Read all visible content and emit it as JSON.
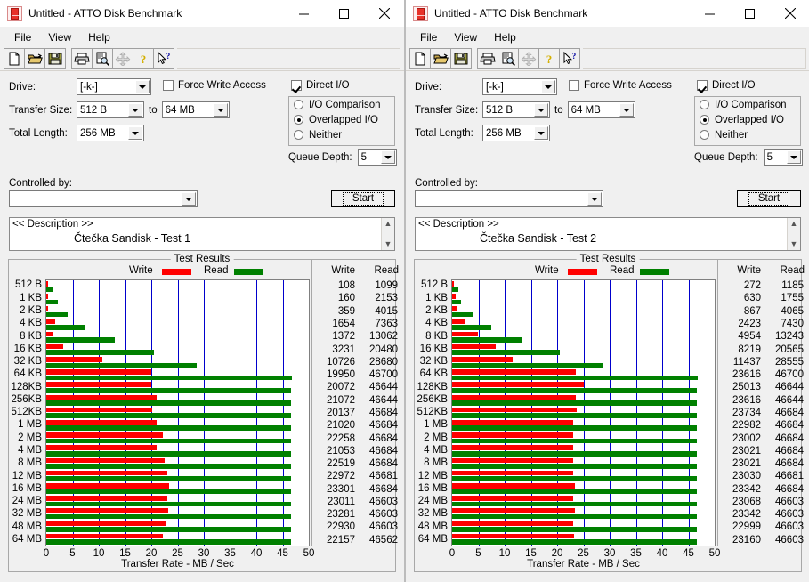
{
  "colors": {
    "write": "#ff0000",
    "read": "#008000",
    "grid": "#0000cc",
    "window_bg": "#f0f0f0",
    "titlebar_bg": "#ffffff"
  },
  "windows": [
    {
      "id": "left",
      "title": "Untitled - ATTO Disk Benchmark",
      "title_icon": "disk-benchmark-icon",
      "window_controls": {
        "minimize": "minimize-icon",
        "maximize": "maximize-icon",
        "close": "close-icon"
      },
      "menu": [
        "File",
        "View",
        "Help"
      ],
      "toolbar": [
        "new-icon",
        "open-icon",
        "save-icon",
        "print-icon",
        "print-preview-icon",
        "move-icon",
        "about-icon",
        "help-icon"
      ],
      "controls": {
        "drive_label": "Drive:",
        "drive_value": "[-k-]",
        "transfer_size_label": "Transfer Size:",
        "transfer_size_from": "512 B",
        "to_label": "to",
        "transfer_size_to": "64 MB",
        "total_length_label": "Total Length:",
        "total_length_value": "256 MB",
        "force_write_access_label": "Force Write Access",
        "force_write_access_checked": false,
        "direct_io_label": "Direct I/O",
        "direct_io_checked": true,
        "io_modes": [
          {
            "label": "I/O Comparison",
            "selected": false
          },
          {
            "label": "Overlapped I/O",
            "selected": true
          },
          {
            "label": "Neither",
            "selected": false
          }
        ],
        "queue_depth_label": "Queue Depth:",
        "queue_depth_value": "5",
        "controlled_by_label": "Controlled by:",
        "controlled_by_value": "",
        "start_label": "Start"
      },
      "description": {
        "header": "<< Description >>",
        "text": "Čtečka Sandisk - Test 1"
      },
      "results": {
        "group_title": "Test Results",
        "legend_write": "Write",
        "legend_read": "Read",
        "col_write": "Write",
        "col_read": "Read"
      },
      "chart_data": {
        "type": "bar",
        "title": "Test Results",
        "xlabel": "Transfer Rate - MB / Sec",
        "ylabel": "",
        "orientation": "horizontal",
        "xlim": [
          0,
          50
        ],
        "xticks": [
          0,
          5,
          10,
          15,
          20,
          25,
          30,
          35,
          40,
          45,
          50
        ],
        "grid": true,
        "legend": [
          "Write",
          "Read"
        ],
        "legend_position": "top",
        "unit_note": "values in KB/s; bars plotted as MB/Sec",
        "categories": [
          "512 B",
          "1 KB",
          "2 KB",
          "4 KB",
          "8 KB",
          "16 KB",
          "32 KB",
          "64 KB",
          "128KB",
          "256KB",
          "512KB",
          "1 MB",
          "2 MB",
          "4 MB",
          "8 MB",
          "12 MB",
          "16 MB",
          "24 MB",
          "32 MB",
          "48 MB",
          "64 MB"
        ],
        "series": [
          {
            "name": "Write",
            "values": [
              108,
              160,
              359,
              1654,
              1372,
              3231,
              10726,
              19950,
              20072,
              21072,
              20137,
              21020,
              22258,
              21053,
              22519,
              22972,
              23301,
              23011,
              23281,
              22930,
              22157
            ]
          },
          {
            "name": "Read",
            "values": [
              1099,
              2153,
              4015,
              7363,
              13062,
              20480,
              28680,
              46700,
              46644,
              46644,
              46684,
              46684,
              46684,
              46684,
              46684,
              46681,
              46684,
              46603,
              46603,
              46603,
              46562
            ]
          }
        ]
      }
    },
    {
      "id": "right",
      "title": "Untitled - ATTO Disk Benchmark",
      "title_icon": "disk-benchmark-icon",
      "window_controls": {
        "minimize": "minimize-icon",
        "maximize": "maximize-icon",
        "close": "close-icon"
      },
      "menu": [
        "File",
        "View",
        "Help"
      ],
      "toolbar": [
        "new-icon",
        "open-icon",
        "save-icon",
        "print-icon",
        "print-preview-icon",
        "move-icon",
        "about-icon",
        "help-icon"
      ],
      "controls": {
        "drive_label": "Drive:",
        "drive_value": "[-k-]",
        "transfer_size_label": "Transfer Size:",
        "transfer_size_from": "512 B",
        "to_label": "to",
        "transfer_size_to": "64 MB",
        "total_length_label": "Total Length:",
        "total_length_value": "256 MB",
        "force_write_access_label": "Force Write Access",
        "force_write_access_checked": false,
        "direct_io_label": "Direct I/O",
        "direct_io_checked": true,
        "io_modes": [
          {
            "label": "I/O Comparison",
            "selected": false
          },
          {
            "label": "Overlapped I/O",
            "selected": true
          },
          {
            "label": "Neither",
            "selected": false
          }
        ],
        "queue_depth_label": "Queue Depth:",
        "queue_depth_value": "5",
        "controlled_by_label": "Controlled by:",
        "controlled_by_value": "",
        "start_label": "Start"
      },
      "description": {
        "header": "<< Description >>",
        "text": "Čtečka Sandisk - Test 2"
      },
      "results": {
        "group_title": "Test Results",
        "legend_write": "Write",
        "legend_read": "Read",
        "col_write": "Write",
        "col_read": "Read"
      },
      "chart_data": {
        "type": "bar",
        "title": "Test Results",
        "xlabel": "Transfer Rate - MB / Sec",
        "ylabel": "",
        "orientation": "horizontal",
        "xlim": [
          0,
          50
        ],
        "xticks": [
          0,
          5,
          10,
          15,
          20,
          25,
          30,
          35,
          40,
          45,
          50
        ],
        "grid": true,
        "legend": [
          "Write",
          "Read"
        ],
        "legend_position": "top",
        "unit_note": "values in KB/s; bars plotted as MB/Sec",
        "categories": [
          "512 B",
          "1 KB",
          "2 KB",
          "4 KB",
          "8 KB",
          "16 KB",
          "32 KB",
          "64 KB",
          "128KB",
          "256KB",
          "512KB",
          "1 MB",
          "2 MB",
          "4 MB",
          "8 MB",
          "12 MB",
          "16 MB",
          "24 MB",
          "32 MB",
          "48 MB",
          "64 MB"
        ],
        "series": [
          {
            "name": "Write",
            "values": [
              272,
              630,
              867,
              2423,
              4954,
              8219,
              11437,
              23616,
              25013,
              23616,
              23734,
              22982,
              23002,
              23021,
              23021,
              23030,
              23342,
              23068,
              23342,
              22999,
              23160
            ]
          },
          {
            "name": "Read",
            "values": [
              1185,
              1755,
              4065,
              7430,
              13243,
              20565,
              28555,
              46700,
              46644,
              46644,
              46684,
              46684,
              46684,
              46684,
              46684,
              46681,
              46684,
              46603,
              46603,
              46603,
              46603
            ]
          }
        ]
      }
    }
  ]
}
